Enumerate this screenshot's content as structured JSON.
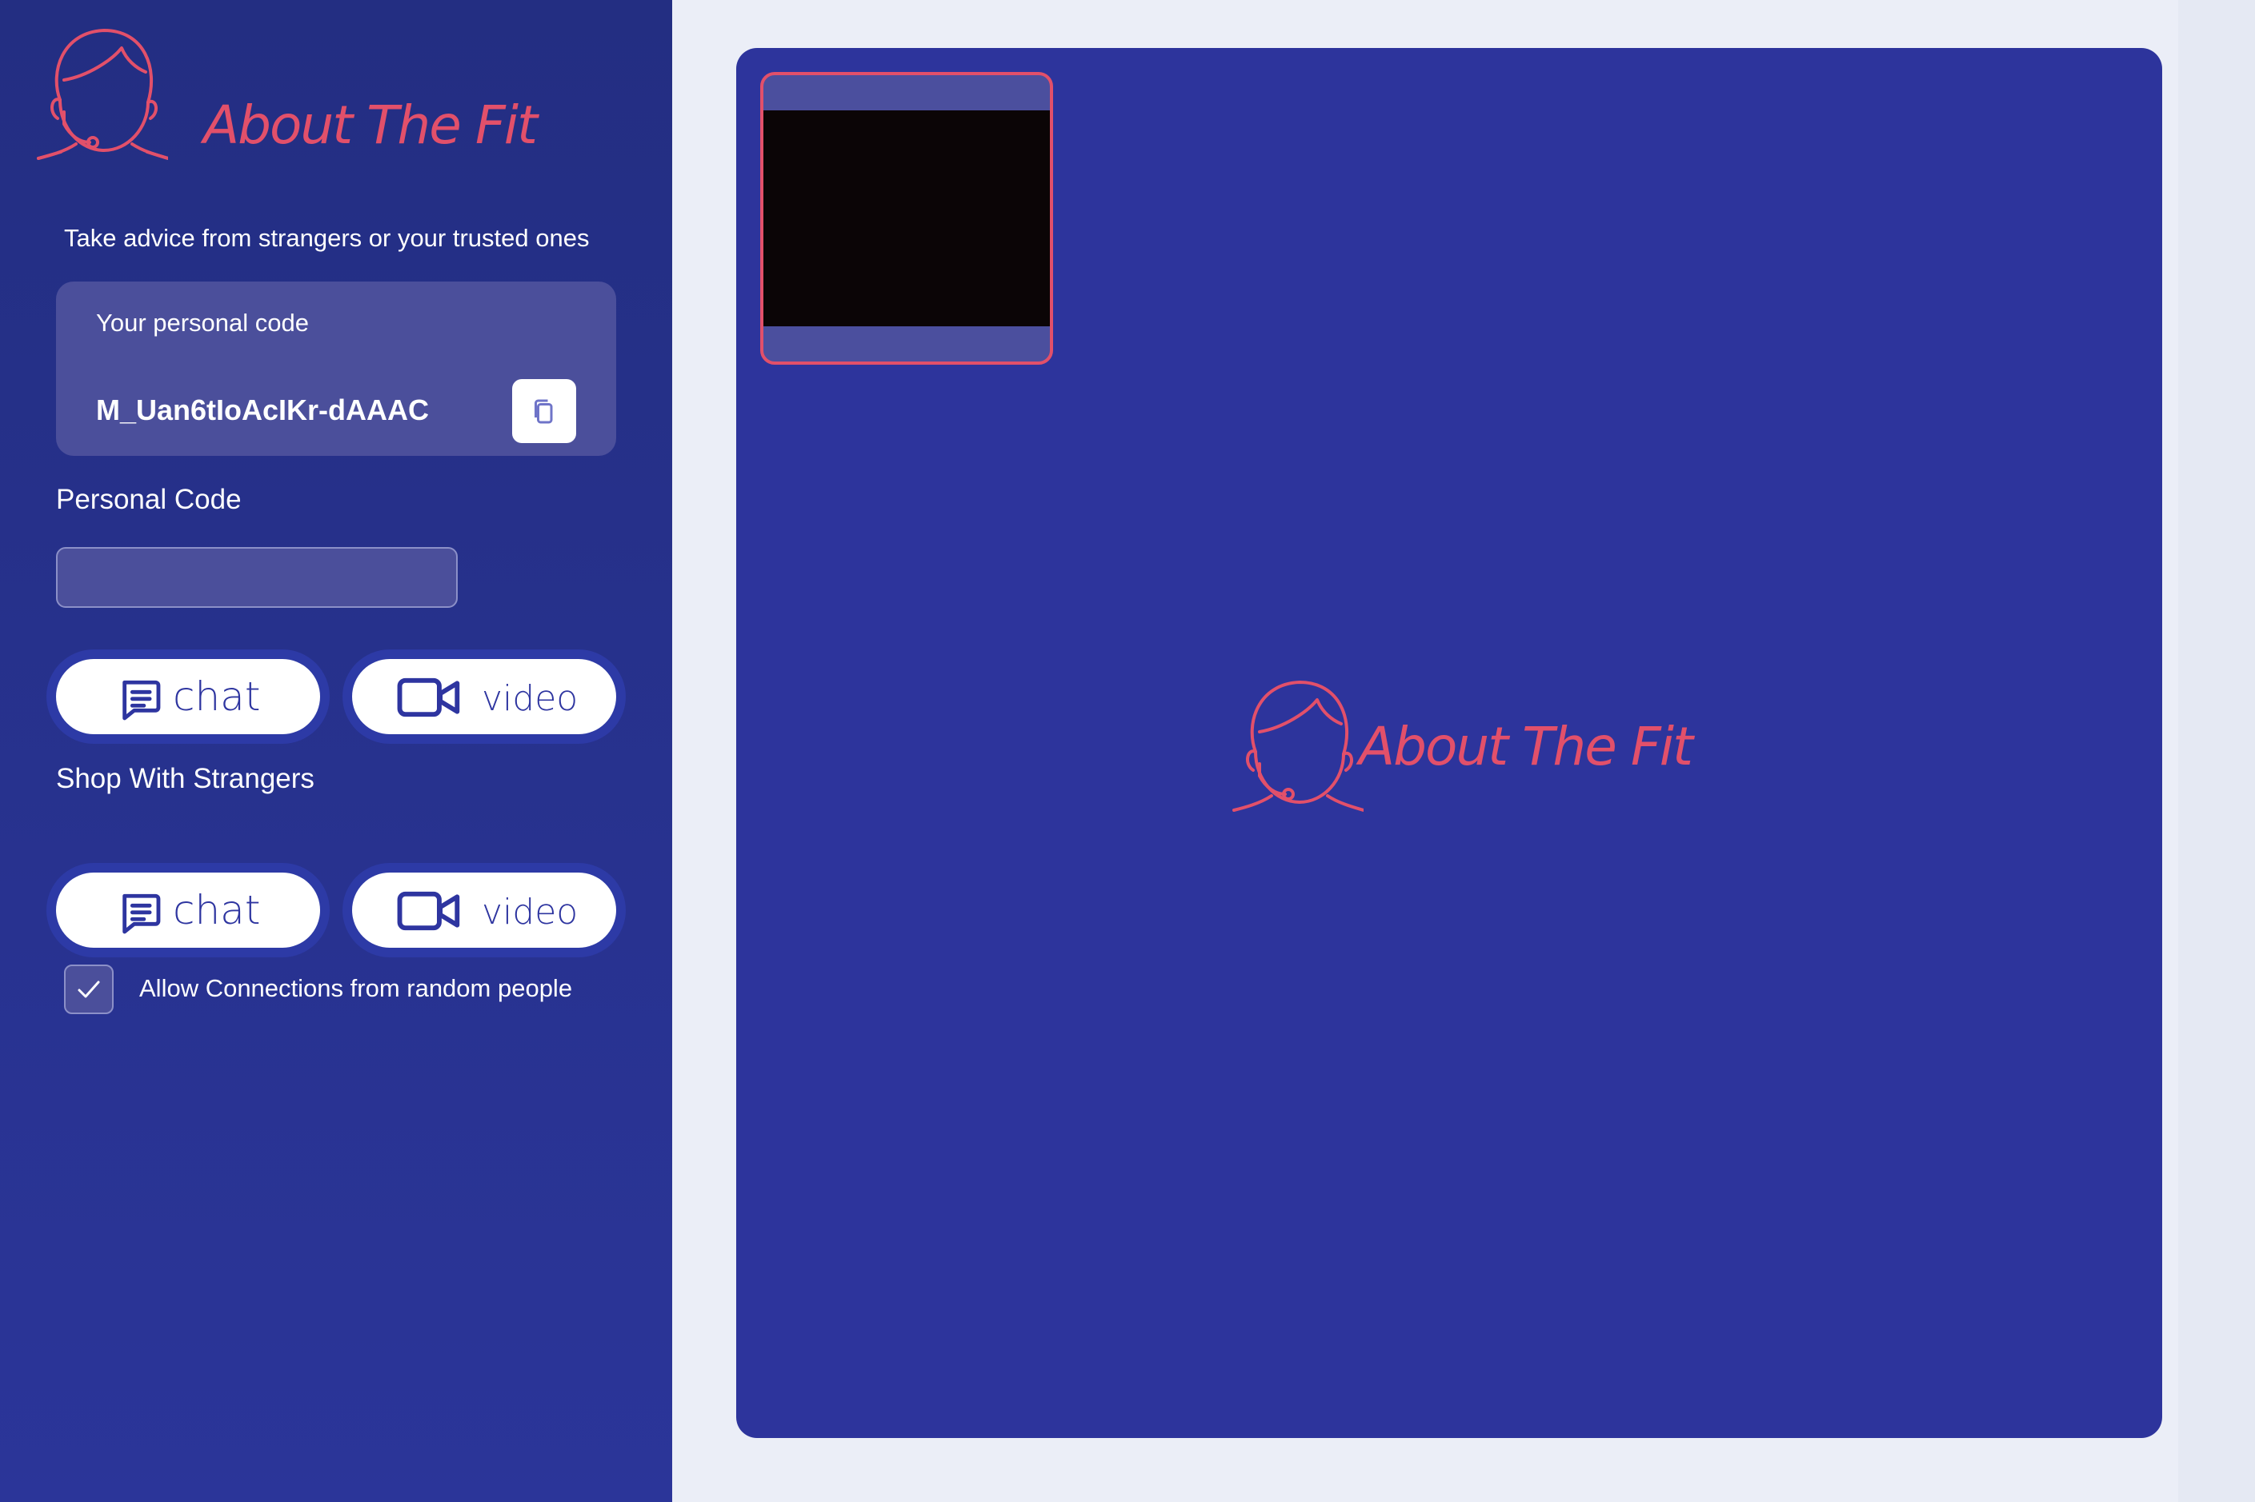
{
  "brand": {
    "name": "About The Fit",
    "color": "#e2506a"
  },
  "sidebar": {
    "tagline": "Take advice from strangers or your trusted ones",
    "personal_code_card": {
      "label": "Your personal code",
      "value": "M_Uan6tIoAcIKr-dAAAC",
      "copy_icon": "copy-icon"
    },
    "personal_code_field": {
      "label": "Personal Code",
      "value": "",
      "placeholder": ""
    },
    "personal_actions": {
      "chat_label": "chat",
      "video_label": "video"
    },
    "strangers": {
      "title": "Shop With Strangers",
      "chat_label": "chat",
      "video_label": "video"
    },
    "allow_random": {
      "label": "Allow Connections from random people",
      "checked": true
    }
  },
  "colors": {
    "sidebar_bg": "#2a3393",
    "panel_bg": "#2d349c",
    "card_bg": "#4b4f9b",
    "accent": "#e2506a",
    "button_text": "#2e35a0"
  }
}
